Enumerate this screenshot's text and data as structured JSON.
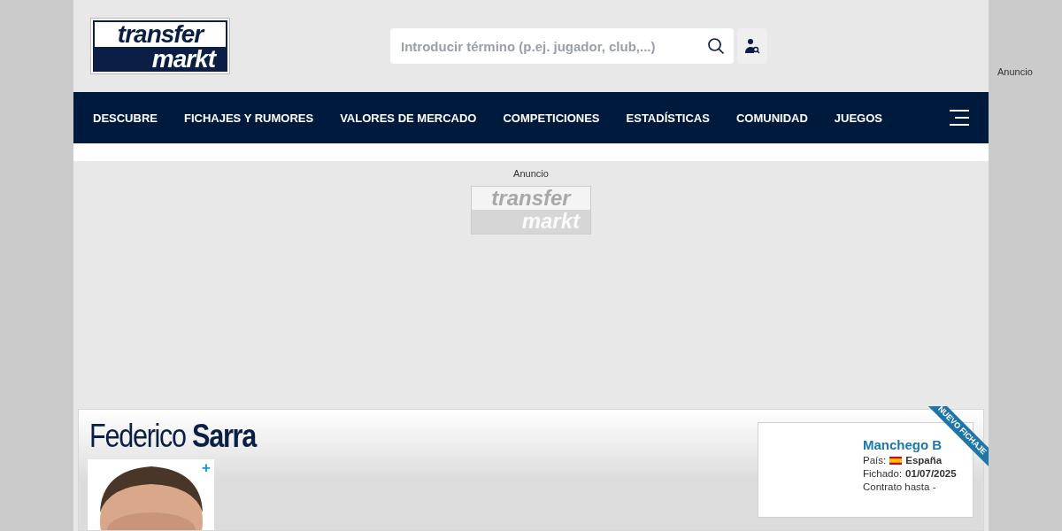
{
  "header": {
    "logo": {
      "top": "transfer",
      "bottom": "markt"
    },
    "search": {
      "placeholder": "Introducir término (p.ej. jugador, club,...)"
    }
  },
  "nav": {
    "items": [
      {
        "label": "DESCUBRE"
      },
      {
        "label": "FICHAJES Y RUMORES"
      },
      {
        "label": "VALORES DE MERCADO"
      },
      {
        "label": "COMPETICIONES"
      },
      {
        "label": "ESTADÍSTICAS"
      },
      {
        "label": "COMUNIDAD"
      },
      {
        "label": "JUEGOS"
      }
    ]
  },
  "side_ad": {
    "label": "Anuncio"
  },
  "ad": {
    "label": "Anuncio",
    "logo": {
      "top": "transfer",
      "bottom": "markt"
    }
  },
  "player": {
    "first_name": "Federico",
    "last_name": "Sarra",
    "photo": {
      "kind": "picture",
      "more": "+"
    },
    "club": {
      "name": "Manchego B",
      "country_label": "País:",
      "country": "España",
      "signed_label": "Fichado:",
      "signed_date": "01/07/2025",
      "contract": "Contrato hasta -",
      "ribbon": "NUEVO FICHAJE"
    }
  }
}
